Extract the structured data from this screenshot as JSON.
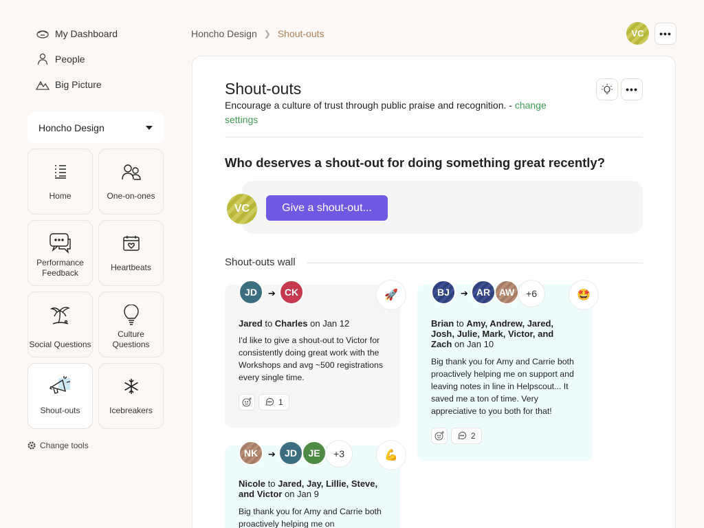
{
  "sidebar": {
    "nav": [
      {
        "label": "My Dashboard",
        "icon": "dashboard-icon"
      },
      {
        "label": "People",
        "icon": "person-icon"
      },
      {
        "label": "Big Picture",
        "icon": "mountain-icon"
      }
    ],
    "team": "Honcho Design",
    "tools": [
      {
        "label": "Home",
        "icon": "list-icon"
      },
      {
        "label": "One-on-ones",
        "icon": "people-icon"
      },
      {
        "label": "Performance Feedback",
        "icon": "chat-bubbles-icon"
      },
      {
        "label": "Heartbeats",
        "icon": "calendar-heart-icon"
      },
      {
        "label": "Social Questions",
        "icon": "palm-tree-icon"
      },
      {
        "label": "Culture Questions",
        "icon": "lightbulb-icon"
      },
      {
        "label": "Shout-outs",
        "icon": "megaphone-icon",
        "active": true
      },
      {
        "label": "Icebreakers",
        "icon": "snowflake-icon"
      }
    ],
    "change_tools": "Change tools"
  },
  "header": {
    "breadcrumb_home": "Honcho Design",
    "breadcrumb_current": "Shout-outs",
    "user_initials": "VC"
  },
  "main": {
    "title": "Shout-outs",
    "description": "Encourage a culture of trust through public praise and recognition. - ",
    "change_link": "change settings",
    "question": "Who deserves a shout-out for doing something great recently?",
    "compose_initials": "VC",
    "give_button": "Give a shout-out...",
    "wall_title": "Shout-outs wall"
  },
  "shoutouts": [
    {
      "from_initials": "JD",
      "to_initials": [
        "CK"
      ],
      "more": "",
      "emoji": "🚀",
      "from_name": "Jared",
      "to_word": "to",
      "to_names": "Charles",
      "date": "on Jan 12",
      "body": "I'd like to give a shout-out to Victor for consistently doing great work with the Workshops and avg ~500 registrations every single time.",
      "comments": "1"
    },
    {
      "from_initials": "BJ",
      "to_initials": [
        "AR",
        "AW"
      ],
      "more": "+6",
      "emoji": "🤩",
      "from_name": "Brian",
      "to_word": "to",
      "to_names": "Amy, Andrew, Jared, Josh, Julie, Mark, Victor, and Zach",
      "date": "on Jan 10",
      "body": "Big thank you for Amy and Carrie both proactively helping me on support and leaving notes in line in Helpscout... It saved me a ton of time. Very appreciative to you both for that!",
      "comments": "2"
    },
    {
      "from_initials": "NK",
      "to_initials": [
        "JD",
        "JE"
      ],
      "more": "+3",
      "emoji": "💪",
      "from_name": "Nicole",
      "to_word": "to",
      "to_names": "Jared, Jay, Lillie, Steve, and Victor",
      "date": "on Jan 9",
      "body": "Big thank you for Amy and Carrie both proactively helping me on",
      "comments": ""
    }
  ],
  "colors": {
    "accent": "#7158e2",
    "link": "#3f9a53",
    "breadcrumb_current": "#b08155",
    "card_gray": "#f6f6f7",
    "card_cyan": "#effcfc"
  }
}
